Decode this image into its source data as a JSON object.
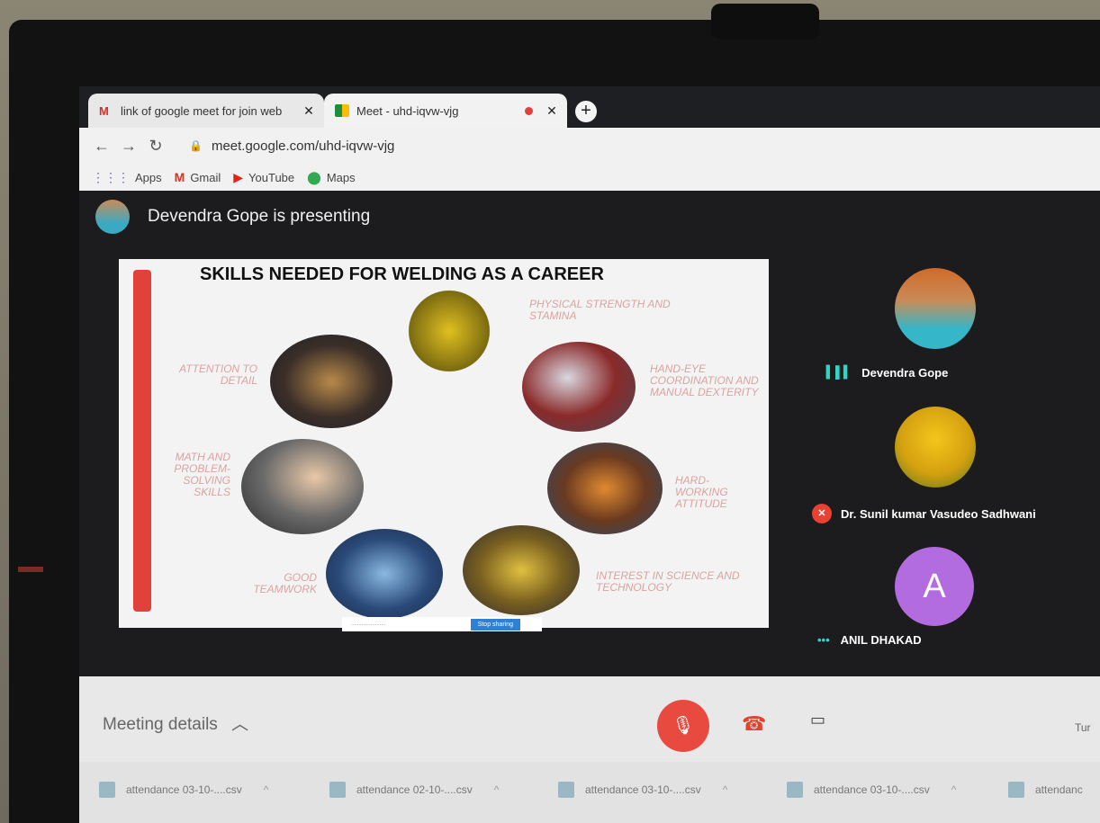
{
  "tabs": [
    {
      "label": "link of google meet for join web",
      "close": "✕"
    },
    {
      "label": "Meet - uhd-iqvw-vjg",
      "close": "✕"
    }
  ],
  "new_tab": "+",
  "address": {
    "url": "meet.google.com/uhd-iqvw-vjg"
  },
  "bookmarks": [
    {
      "label": "Apps",
      "icon": "apps-grid-icon"
    },
    {
      "label": "Gmail",
      "icon": "gmail-icon"
    },
    {
      "label": "YouTube",
      "icon": "youtube-icon"
    },
    {
      "label": "Maps",
      "icon": "maps-icon"
    }
  ],
  "meet": {
    "presenting_text": "Devendra Gope is presenting",
    "participants": [
      {
        "name": "Devendra Gope",
        "status": "speaking"
      },
      {
        "name": "Dr. Sunil kumar Vasudeo Sadhwani",
        "status": "muted"
      },
      {
        "name": "ANIL DHAKAD",
        "initial": "A",
        "status": "more"
      }
    ]
  },
  "slide": {
    "title": "SKILLS NEEDED FOR WELDING AS A CAREER",
    "skills": [
      "PHYSICAL STRENGTH AND STAMINA",
      "HAND-EYE COORDINATION AND MANUAL DEXTERITY",
      "HARD-WORKING ATTITUDE",
      "INTEREST IN SCIENCE AND TECHNOLOGY",
      "GOOD TEAMWORK",
      "MATH AND PROBLEM-SOLVING SKILLS",
      "ATTENTION TO DETAIL"
    ],
    "stop_sharing": "Stop sharing"
  },
  "bottom": {
    "meeting_details": "Meeting details",
    "turn_text": "Tur"
  },
  "downloads": [
    {
      "file": "attendance 03-10-....csv"
    },
    {
      "file": "attendance 02-10-....csv"
    },
    {
      "file": "attendance 03-10-....csv"
    },
    {
      "file": "attendance 03-10-....csv"
    },
    {
      "file": "attendanc"
    }
  ],
  "colors": {
    "accent_red": "#e94235",
    "avatar_purple": "#b36be0"
  }
}
